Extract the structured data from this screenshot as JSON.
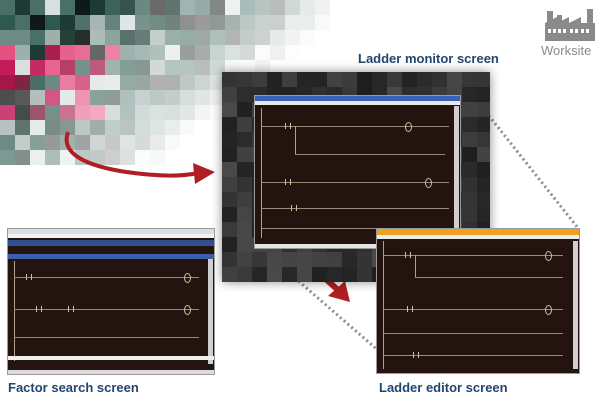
{
  "captions": {
    "ladder_monitor": "Ladder monitor screen",
    "factor_search": "Factor search screen",
    "ladder_editor": "Ladder editor screen",
    "worksite": "Worksite"
  },
  "icons": {
    "worksite": "factory-icon",
    "flow_arrow": "curved-arrow-icon",
    "down_arrow": "down-arrow-icon"
  },
  "colors": {
    "caption": "#24466e",
    "worksite_label": "#8a8a8a",
    "arrow": "#b01e24",
    "connector": "#8c8c8c",
    "screen_bg": "#241410",
    "monitor_titlebar": "#3a62b8",
    "editor_titlebar": "#f0a020"
  }
}
